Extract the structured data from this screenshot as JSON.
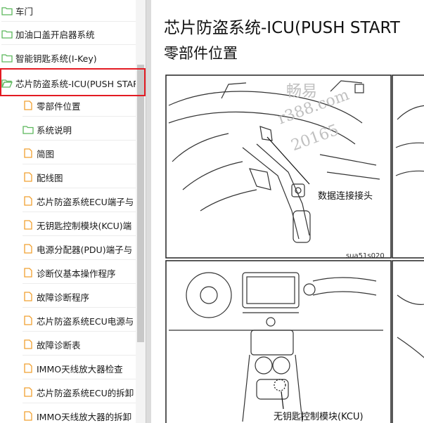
{
  "tree": {
    "items": [
      {
        "label": "车门",
        "icon": "folder-icon",
        "level": 0
      },
      {
        "label": "加油口盖开启器系统",
        "icon": "folder-icon",
        "level": 0
      },
      {
        "label": "智能钥匙系统(I-Key)",
        "icon": "folder-icon",
        "level": 0
      },
      {
        "label": "芯片防盗系统-ICU(PUSH STAR",
        "icon": "folder-open-icon",
        "level": 0,
        "selected": true
      },
      {
        "label": "零部件位置",
        "icon": "document-icon",
        "level": 1
      },
      {
        "label": "系统说明",
        "icon": "folder-icon",
        "level": 1
      },
      {
        "label": "简图",
        "icon": "document-icon",
        "level": 1
      },
      {
        "label": "配线图",
        "icon": "document-icon",
        "level": 1
      },
      {
        "label": "芯片防盗系统ECU端子与",
        "icon": "document-icon",
        "level": 1
      },
      {
        "label": "无钥匙控制模块(KCU)端",
        "icon": "document-icon",
        "level": 1
      },
      {
        "label": "电源分配器(PDU)端子与",
        "icon": "document-icon",
        "level": 1
      },
      {
        "label": "诊断仪基本操作程序",
        "icon": "document-icon",
        "level": 1
      },
      {
        "label": "故障诊断程序",
        "icon": "document-icon",
        "level": 1
      },
      {
        "label": "芯片防盗系统ECU电源与",
        "icon": "document-icon",
        "level": 1
      },
      {
        "label": "故障诊断表",
        "icon": "document-icon",
        "level": 1
      },
      {
        "label": "IMMO天线放大器检查",
        "icon": "document-icon",
        "level": 1
      },
      {
        "label": "芯片防盗系统ECU的拆卸",
        "icon": "document-icon",
        "level": 1
      },
      {
        "label": "IMMO天线放大器的拆卸",
        "icon": "document-icon",
        "level": 1
      }
    ]
  },
  "document": {
    "title": "芯片防盗系统-ICU(PUSH START",
    "subtitle": "零部件位置",
    "figure": {
      "callout_top": "数据连接接头",
      "code_top": "sua51s020",
      "callout_bottom": "无钥匙控制模块(KCU)"
    },
    "watermark": {
      "line1": "畅易",
      "line2": "r388.com",
      "line3": "20165"
    }
  },
  "colors": {
    "highlight": "#e31b23",
    "folder": "#5cb85c",
    "document": "#f0a030"
  }
}
